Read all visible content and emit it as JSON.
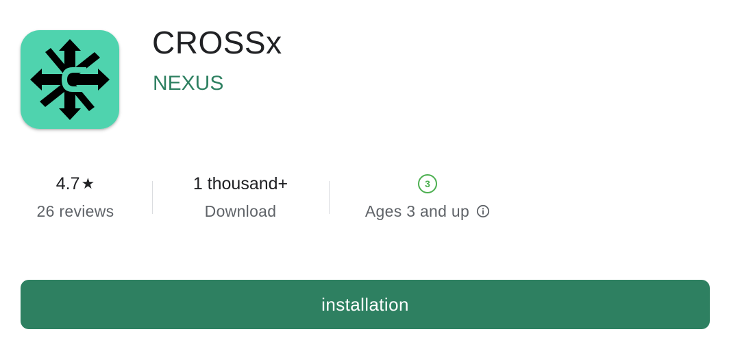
{
  "app": {
    "title": "CROSSx",
    "developer": "NEXUS",
    "icon": "crossx-logo-icon",
    "icon_background": "#4fd3ae"
  },
  "stats": {
    "rating": {
      "value": "4.7",
      "star_icon": "star-icon",
      "label": "26 reviews"
    },
    "downloads": {
      "value": "1 thousand+",
      "label": "Download"
    },
    "content_rating": {
      "badge": "3",
      "label": "Ages 3 and up",
      "info_icon": "info-icon"
    }
  },
  "install_button": {
    "label": "installation"
  },
  "colors": {
    "accent": "#2e8061",
    "age_badge": "#4caf50",
    "secondary_text": "#5f6368"
  }
}
